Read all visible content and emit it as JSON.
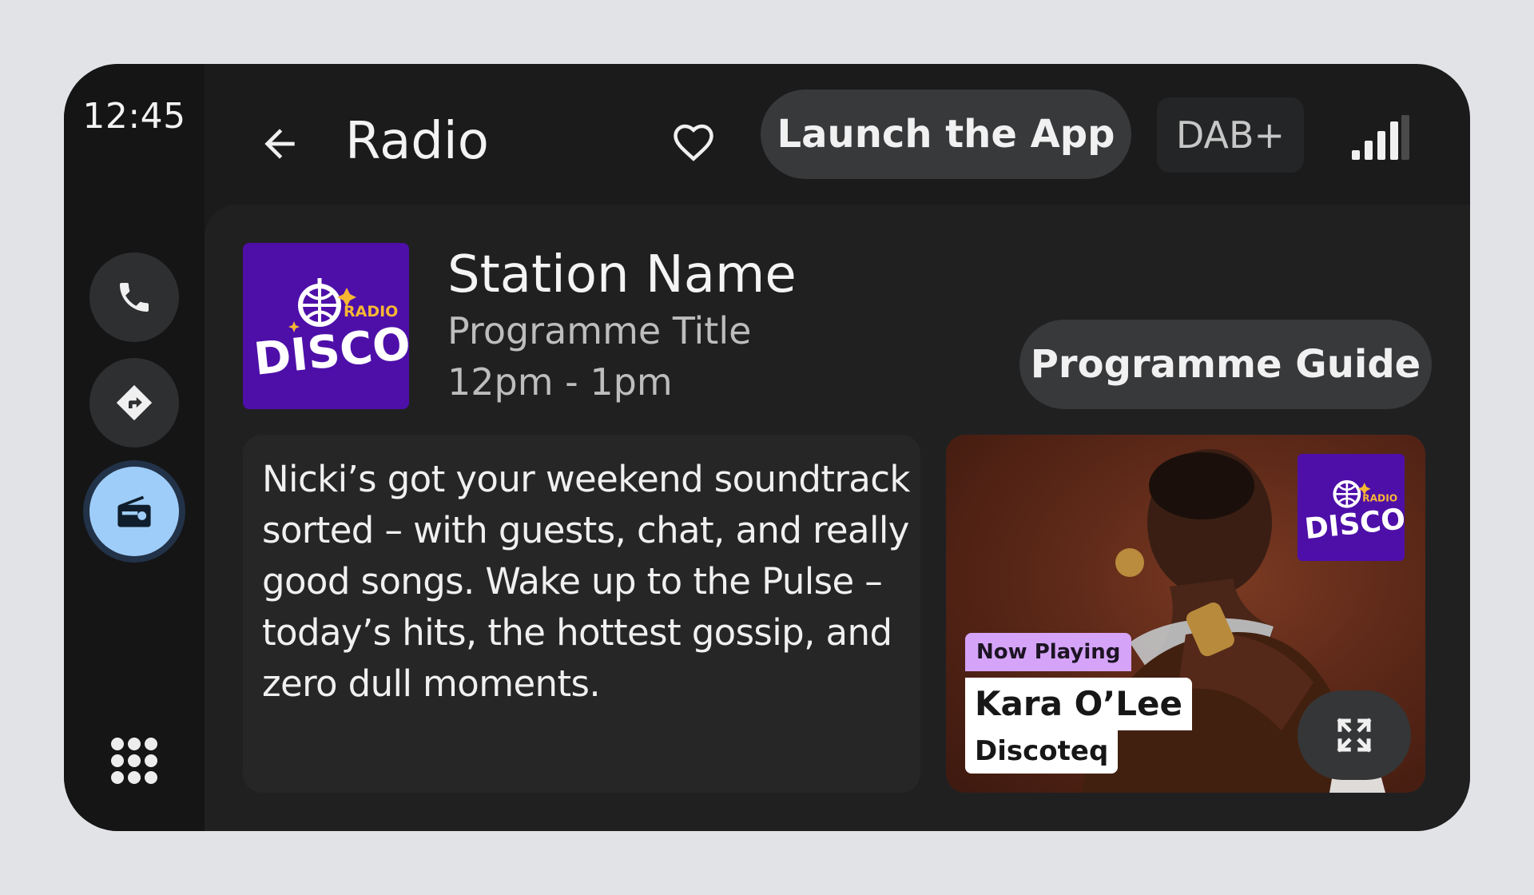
{
  "status": {
    "clock": "12:45"
  },
  "rail": {
    "items": [
      {
        "name": "phone",
        "icon": "phone-icon"
      },
      {
        "name": "navigation",
        "icon": "directions-icon"
      },
      {
        "name": "radio",
        "icon": "radio-icon",
        "active": true
      }
    ],
    "apps_icon": "apps-grid-icon"
  },
  "header": {
    "title": "Radio",
    "favorite_icon": "heart-outline-icon",
    "launch_label": "Launch the App",
    "source_badge": "DAB+",
    "signal_icon": "signal-strength-icon"
  },
  "station": {
    "logo": {
      "line1": "RADIO",
      "line2": "DISCO"
    },
    "name": "Station Name",
    "programme_title": "Programme Title",
    "time": "12pm - 1pm",
    "guide_label": "Programme Guide",
    "description": "Nicki’s got your weekend soundtrack sorted – with guests, chat, and really good songs. Wake up to the Pulse – today’s hits, the hottest gossip, and zero dull moments."
  },
  "now_playing": {
    "badge": "Now Playing",
    "artist": "Kara O’Lee",
    "track": "Discoteq",
    "expand_icon": "fullscreen-icon"
  },
  "colors": {
    "background": "#e1e3e6",
    "device": "#1b1b1c",
    "accent_active": "#9fcdf9",
    "logo_purple": "#4e0fa9",
    "now_playing_badge": "#d5a4f8"
  }
}
